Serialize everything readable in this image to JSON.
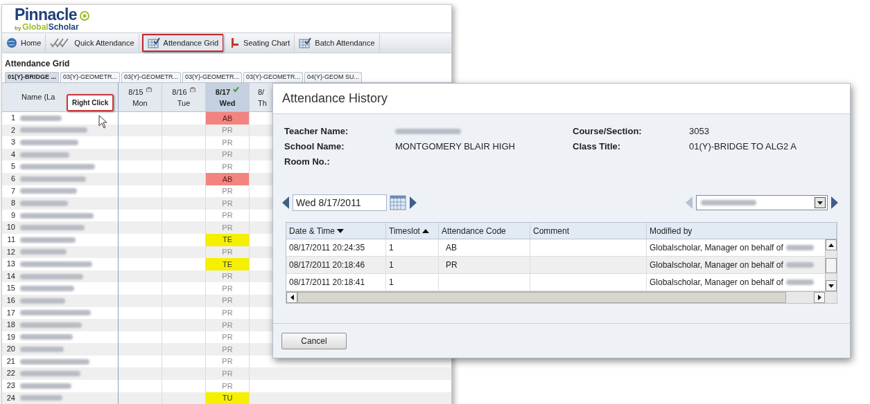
{
  "logo": {
    "brand": "Pinnacle",
    "sub_prefix": "by",
    "sub_a": "Global",
    "sub_b": "Scholar"
  },
  "toolbar": [
    {
      "label": "Home",
      "kind": "globe",
      "selected": false
    },
    {
      "label": "Quick Attendance",
      "kind": "checks",
      "selected": false
    },
    {
      "label": "Attendance Grid",
      "kind": "grid",
      "selected": true
    },
    {
      "label": "Seating Chart",
      "kind": "chair",
      "selected": false
    },
    {
      "label": "Batch Attendance",
      "kind": "grid",
      "selected": false
    }
  ],
  "page_title": "Attendance Grid",
  "tabs": [
    {
      "label": "01(Y)-BRIDGE ...",
      "selected": true
    },
    {
      "label": "03(Y)-GEOMETR...",
      "selected": false
    },
    {
      "label": "03(Y)-GEOMETR...",
      "selected": false
    },
    {
      "label": "03(Y)-GEOMETR...",
      "selected": false
    },
    {
      "label": "03(Y)-GEOMETR...",
      "selected": false
    },
    {
      "label": "04(Y)-GEOM SU...",
      "selected": false
    }
  ],
  "grid": {
    "name_header": "Name (La",
    "days": [
      {
        "date": "8/15",
        "day": "Mon",
        "kind": "locked",
        "selected": false
      },
      {
        "date": "8/16",
        "day": "Tue",
        "kind": "locked",
        "selected": false
      },
      {
        "date": "8/17",
        "day": "Wed",
        "kind": "done",
        "selected": true
      },
      {
        "date": "8/",
        "day": "Th",
        "kind": "open",
        "selected": false
      }
    ],
    "rows": [
      {
        "number": "1",
        "code": "AB",
        "kind": "absent"
      },
      {
        "number": "2",
        "code": "PR",
        "kind": "present"
      },
      {
        "number": "3",
        "code": "PR",
        "kind": "present"
      },
      {
        "number": "4",
        "code": "PR",
        "kind": "present"
      },
      {
        "number": "5",
        "code": "PR",
        "kind": "present"
      },
      {
        "number": "6",
        "code": "AB",
        "kind": "absent"
      },
      {
        "number": "7",
        "code": "PR",
        "kind": "present"
      },
      {
        "number": "8",
        "code": "PR",
        "kind": "present"
      },
      {
        "number": "9",
        "code": "PR",
        "kind": "present"
      },
      {
        "number": "10",
        "code": "PR",
        "kind": "present"
      },
      {
        "number": "11",
        "code": "TE",
        "kind": "tardy"
      },
      {
        "number": "12",
        "code": "PR",
        "kind": "present"
      },
      {
        "number": "13",
        "code": "TE",
        "kind": "tardy"
      },
      {
        "number": "14",
        "code": "PR",
        "kind": "present"
      },
      {
        "number": "15",
        "code": "PR",
        "kind": "present"
      },
      {
        "number": "16",
        "code": "PR",
        "kind": "present"
      },
      {
        "number": "17",
        "code": "PR",
        "kind": "present"
      },
      {
        "number": "18",
        "code": "PR",
        "kind": "present"
      },
      {
        "number": "19",
        "code": "PR",
        "kind": "present"
      },
      {
        "number": "20",
        "code": "PR",
        "kind": "present"
      },
      {
        "number": "21",
        "code": "PR",
        "kind": "present"
      },
      {
        "number": "22",
        "code": "PR",
        "kind": "present"
      },
      {
        "number": "23",
        "code": "PR",
        "kind": "present"
      },
      {
        "number": "24",
        "code": "TU",
        "kind": "tardy"
      }
    ]
  },
  "callout": "Right Click",
  "dialog": {
    "title": "Attendance History",
    "fields_left": [
      {
        "label": "Teacher Name:"
      },
      {
        "label": "School Name:",
        "value": "MONTGOMERY BLAIR HIGH"
      },
      {
        "label": "Room No.:"
      }
    ],
    "fields_right": [
      {
        "label": "Course/Section:",
        "value": "3053"
      },
      {
        "label": "Class Title:",
        "value": "01(Y)-BRIDGE TO ALG2 A"
      }
    ],
    "date_value": "Wed 8/17/2011",
    "columns": [
      {
        "label": "Date & Time",
        "sorted": true,
        "ascending": false
      },
      {
        "label": "Timeslot",
        "sorted": true,
        "ascending": true
      },
      {
        "label": "Attendance Code",
        "sorted": false
      },
      {
        "label": "Comment",
        "sorted": false
      },
      {
        "label": "Modified by",
        "sorted": false
      }
    ],
    "rows": [
      {
        "datetime": "08/17/2011 20:24:35",
        "timeslot": "1",
        "code": "AB",
        "modified_by": "Globalscholar, Manager on behalf of"
      },
      {
        "datetime": "08/17/2011 20:18:46",
        "timeslot": "1",
        "code": "PR",
        "modified_by": "Globalscholar, Manager on behalf of"
      },
      {
        "datetime": "08/17/2011 20:18:41",
        "timeslot": "1",
        "modified_by": "Globalscholar, Manager on behalf of"
      }
    ],
    "cancel": "Cancel"
  }
}
